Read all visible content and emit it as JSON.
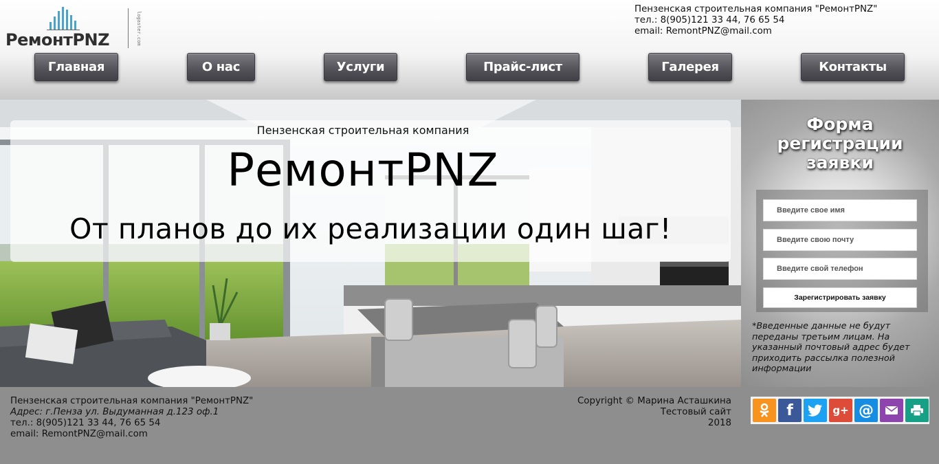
{
  "brand": {
    "logo_text": "РемонтPNZ",
    "logo_side_text": "logaster.com"
  },
  "header_contacts": {
    "company": "Пензенская строительная компания \"РемонтPNZ\"",
    "phone": "тел.: 8(905)121 33 44, 76 65 54",
    "email": "email: RemontPNZ@mail.com"
  },
  "nav": [
    {
      "label": "Главная"
    },
    {
      "label": "О нас"
    },
    {
      "label": "Услуги"
    },
    {
      "label": "Прайс-лист"
    },
    {
      "label": "Галерея"
    },
    {
      "label": "Контакты"
    }
  ],
  "hero": {
    "subtitle": "Пензенская строительная компания",
    "title": "РемонтPNZ",
    "slogan": "От планов до их реализации один шаг!"
  },
  "form": {
    "title_line1": "Форма",
    "title_line2": "регистрации",
    "title_line3": "заявки",
    "name_placeholder": "Введите свое имя",
    "email_placeholder": "Введите свою почту",
    "phone_placeholder": "Введите свой телефон",
    "submit_label": "Зарегистрировать заявку",
    "note": "*Введенные данные не будут переданы третьим лицам. На указанный почтовый адрес будет приходить рассылка полезной информации"
  },
  "footer": {
    "company": "Пензенская строительная компания \"РемонтPNZ\"",
    "address": "Адрес: г.Пенза ул. Выдуманная д.123 оф.1",
    "phone": "тел.: 8(905)121 33 44, 76 65 54",
    "email": "email: RemontPNZ@mail.com",
    "copyright": "Copyright © Марина Асташкина",
    "site_note": "Тестовый сайт",
    "year": "2018"
  },
  "share": [
    {
      "icon": "odnoklassniki-icon",
      "color": "#f7931e"
    },
    {
      "icon": "facebook-icon",
      "color": "#3b5998"
    },
    {
      "icon": "twitter-icon",
      "color": "#1da1f2"
    },
    {
      "icon": "google-plus-icon",
      "color": "#dd4b39"
    },
    {
      "icon": "mail-ru-icon",
      "color": "#168de2"
    },
    {
      "icon": "email-icon",
      "color": "#8e44ad"
    },
    {
      "icon": "print-icon",
      "color": "#16a085"
    }
  ]
}
